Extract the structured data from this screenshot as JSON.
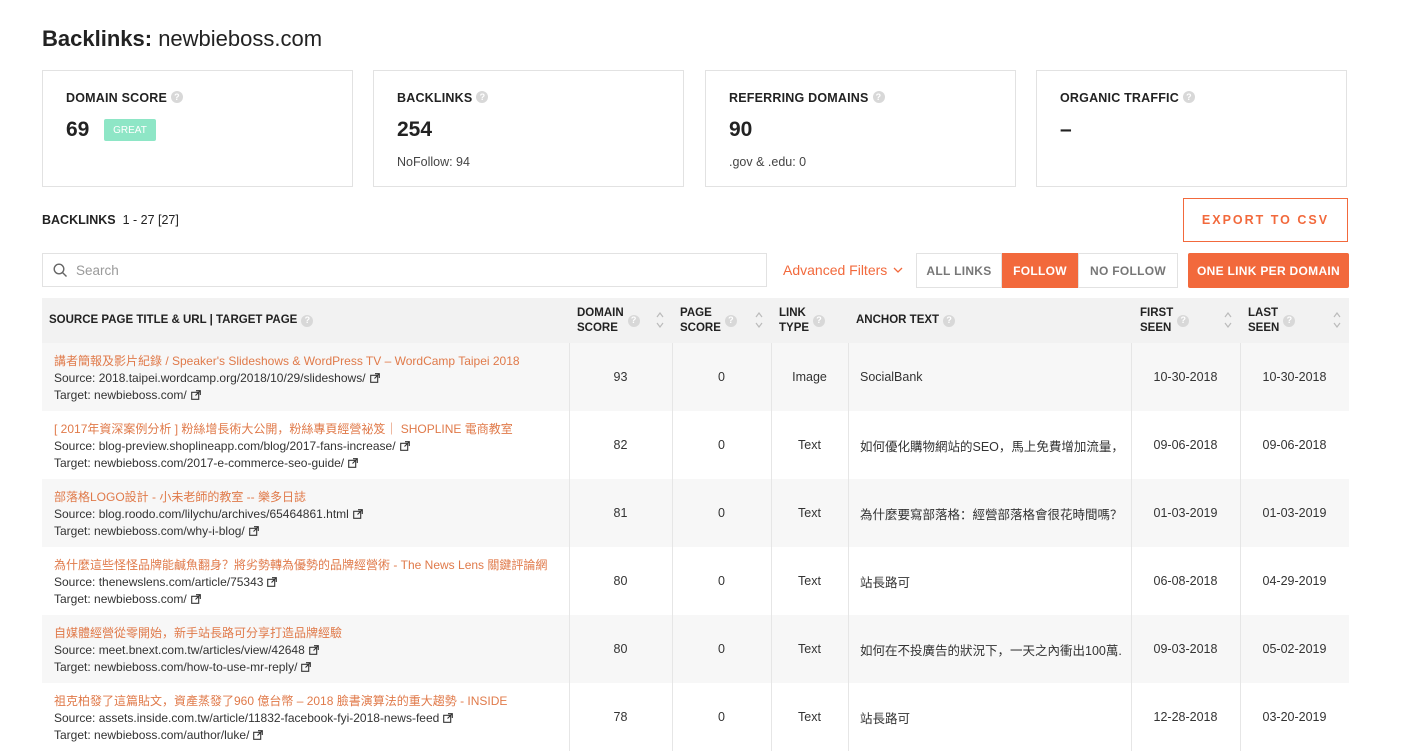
{
  "page": {
    "title_bold": "Backlinks:",
    "title_domain": "newbieboss.com"
  },
  "cards": [
    {
      "label": "DOMAIN SCORE",
      "value": "69",
      "badge": "GREAT",
      "sub": ""
    },
    {
      "label": "BACKLINKS",
      "value": "254",
      "sub": "NoFollow: 94"
    },
    {
      "label": "REFERRING DOMAINS",
      "value": "90",
      "sub": ".gov & .edu: 0"
    },
    {
      "label": "ORGANIC TRAFFIC",
      "value": "–",
      "sub": ""
    }
  ],
  "list_header": {
    "label": "BACKLINKS",
    "range": "1 - 27 [27]"
  },
  "export_label": "EXPORT TO CSV",
  "search": {
    "placeholder": "Search",
    "value": ""
  },
  "advanced_filters": "Advanced Filters",
  "filters": {
    "all": "ALL LINKS",
    "follow": "FOLLOW",
    "nofollow": "NO FOLLOW",
    "one_link": "ONE LINK PER DOMAIN",
    "active": "FOLLOW"
  },
  "columns": {
    "source": "SOURCE PAGE TITLE & URL | TARGET PAGE",
    "domain_score_1": "DOMAIN",
    "domain_score_2": "SCORE",
    "page_score_1": "PAGE",
    "page_score_2": "SCORE",
    "link_type_1": "LINK",
    "link_type_2": "TYPE",
    "anchor": "ANCHOR TEXT",
    "first_seen_1": "FIRST",
    "first_seen_2": "SEEN",
    "last_seen_1": "LAST",
    "last_seen_2": "SEEN"
  },
  "rows": [
    {
      "title": "講者簡報及影片紀錄 / Speaker's Slideshows & WordPress TV – WordCamp Taipei 2018",
      "source": "Source: 2018.taipei.wordcamp.org/2018/10/29/slideshows/",
      "target": "Target: newbieboss.com/",
      "domain_score": "93",
      "page_score": "0",
      "link_type": "Image",
      "anchor": "SocialBank",
      "first_seen": "10-30-2018",
      "last_seen": "10-30-2018"
    },
    {
      "title": "[ 2017年資深案例分析 ] 粉絲增長術大公開，粉絲專頁經營祕笈｜ SHOPLINE 電商教室",
      "source": "Source: blog-preview.shoplineapp.com/blog/2017-fans-increase/",
      "target": "Target: newbieboss.com/2017-e-commerce-seo-guide/",
      "domain_score": "82",
      "page_score": "0",
      "link_type": "Text",
      "anchor": "如何優化購物網站的SEO，馬上免費增加流量，...",
      "first_seen": "09-06-2018",
      "last_seen": "09-06-2018"
    },
    {
      "title": "部落格LOGO設計 - 小未老師的教室 -- 樂多日誌",
      "source": "Source: blog.roodo.com/lilychu/archives/65464861.html",
      "target": "Target: newbieboss.com/why-i-blog/",
      "domain_score": "81",
      "page_score": "0",
      "link_type": "Text",
      "anchor": "為什麼要寫部落格：經營部落格會很花時間嗎？",
      "first_seen": "01-03-2019",
      "last_seen": "01-03-2019"
    },
    {
      "title": "為什麼這些怪怪品牌能鹹魚翻身？將劣勢轉為優勢的品牌經營術 - The News Lens 關鍵評論網",
      "source": "Source: thenewslens.com/article/75343",
      "target": "Target: newbieboss.com/",
      "domain_score": "80",
      "page_score": "0",
      "link_type": "Text",
      "anchor": "站長路可",
      "first_seen": "06-08-2018",
      "last_seen": "04-29-2019"
    },
    {
      "title": "自媒體經營從零開始，新手站長路可分享打造品牌經驗",
      "source": "Source: meet.bnext.com.tw/articles/view/42648",
      "target": "Target: newbieboss.com/how-to-use-mr-reply/",
      "domain_score": "80",
      "page_score": "0",
      "link_type": "Text",
      "anchor": "如何在不投廣告的狀況下，一天之內衝出100萬...",
      "first_seen": "09-03-2018",
      "last_seen": "05-02-2019"
    },
    {
      "title": "祖克柏發了這篇貼文，資產蒸發了960 億台幣 – 2018 臉書演算法的重大趨勢 - INSIDE",
      "source": "Source: assets.inside.com.tw/article/11832-facebook-fyi-2018-news-feed",
      "target": "Target: newbieboss.com/author/luke/",
      "domain_score": "78",
      "page_score": "0",
      "link_type": "Text",
      "anchor": "站長路可",
      "first_seen": "12-28-2018",
      "last_seen": "03-20-2019"
    }
  ],
  "colors": {
    "accent": "#f2693c",
    "badge": "#8ee6c6",
    "link_title": "#e07a4a"
  }
}
